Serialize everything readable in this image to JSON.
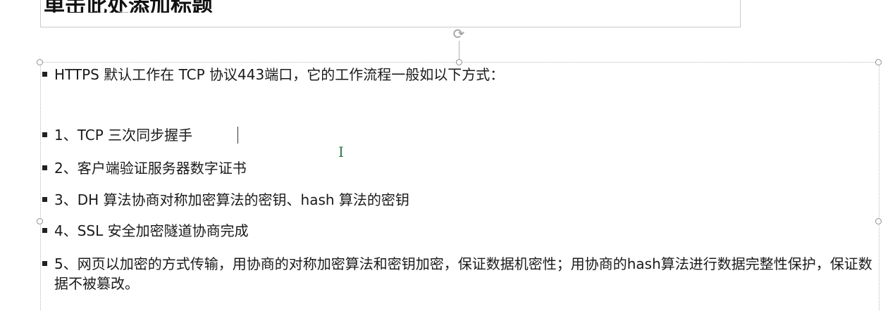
{
  "title": {
    "text": "单击此处添加标题"
  },
  "content": {
    "bullets": [
      {
        "text": "HTTPS 默认工作在 TCP 协议443端口，它的工作流程一般如以下方式："
      },
      {
        "text": "1、TCP 三次同步握手"
      },
      {
        "text": "2、客户端验证服务器数字证书"
      },
      {
        "text": "3、DH 算法协商对称加密算法的密钥、hash 算法的密钥"
      },
      {
        "text": "4、SSL 安全加密隧道协商完成"
      },
      {
        "text": "5、网页以加密的方式传输，用协商的对称加密算法和密钥加密，保证数据机密性；用协商的hash算法进行数据完整性保护，保证数据不被篡改。"
      }
    ]
  },
  "icons": {
    "rotate": "rotate-handle-icon",
    "cursor": "ibeam-cursor-icon"
  }
}
